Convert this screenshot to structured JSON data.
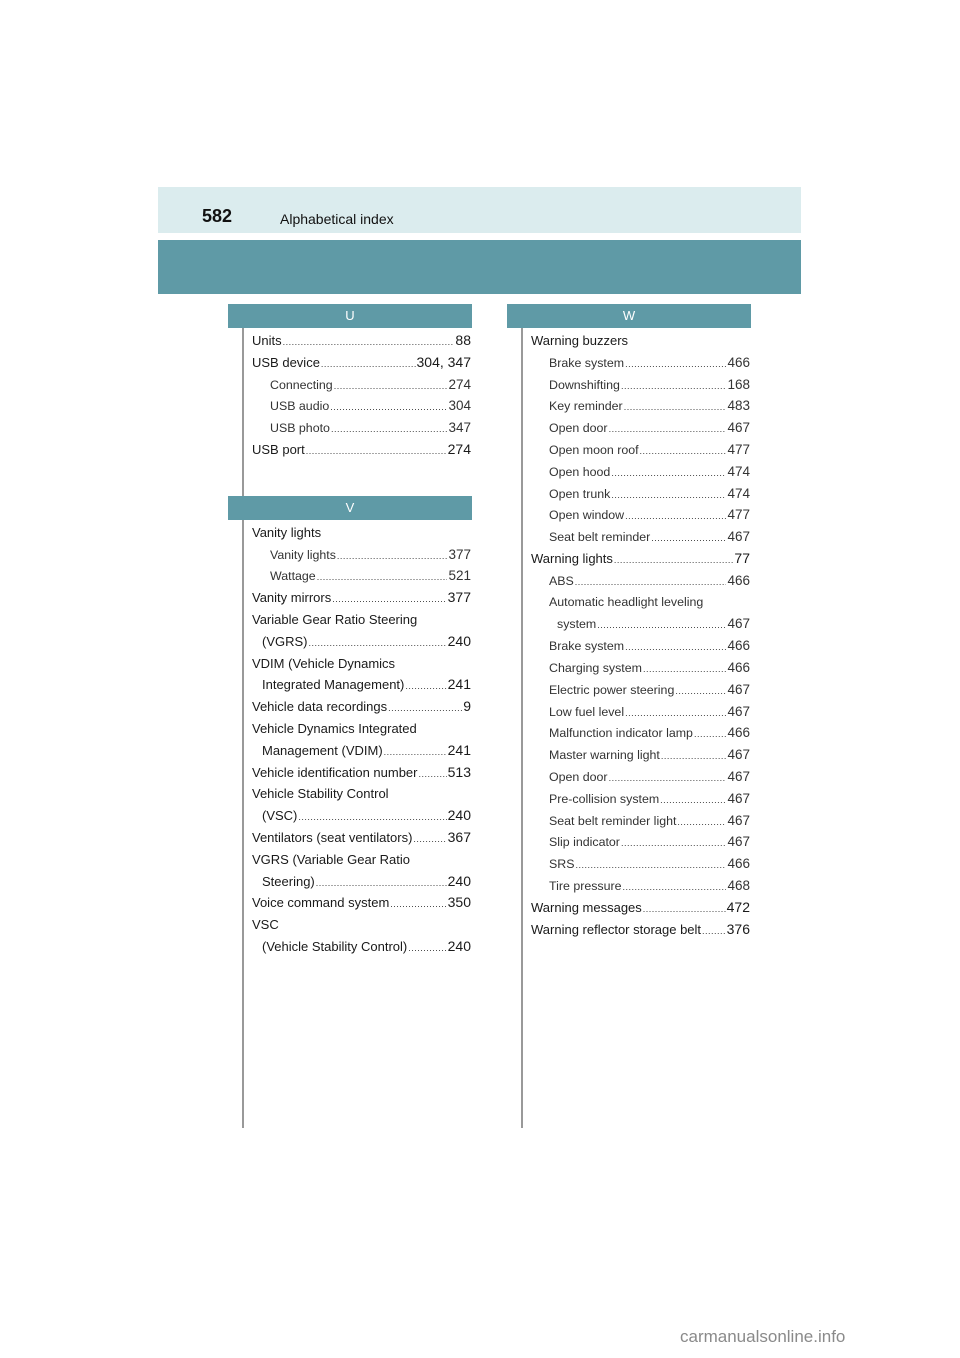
{
  "header": {
    "page_number": "582",
    "section_title": "Alphabetical index"
  },
  "sections": [
    {
      "letter": "U",
      "entries": [
        {
          "label": "Units",
          "page": "88",
          "level": 0
        },
        {
          "label": "USB device",
          "page": "304, 347",
          "level": 0
        },
        {
          "label": "Connecting",
          "page": "274",
          "level": 1
        },
        {
          "label": "USB audio",
          "page": "304",
          "level": 1
        },
        {
          "label": "USB photo",
          "page": "347",
          "level": 1
        },
        {
          "label": "USB port",
          "page": "274",
          "level": 0
        }
      ]
    },
    {
      "letter": "V",
      "entries": [
        {
          "label": "Vanity lights",
          "page": "",
          "level": 0
        },
        {
          "label": "Vanity lights",
          "page": "377",
          "level": 1
        },
        {
          "label": "Wattage",
          "page": "521",
          "level": 1
        },
        {
          "label": "Vanity mirrors",
          "page": "377",
          "level": 0
        },
        {
          "label": "Variable Gear Ratio Steering",
          "page": "",
          "level": 0
        },
        {
          "label": "(VGRS)",
          "page": "240",
          "level": 0,
          "cont": true
        },
        {
          "label": "VDIM (Vehicle Dynamics",
          "page": "",
          "level": 0
        },
        {
          "label": "Integrated Management)",
          "page": "241",
          "level": 0,
          "cont": true
        },
        {
          "label": "Vehicle data recordings",
          "page": "9",
          "level": 0
        },
        {
          "label": "Vehicle Dynamics Integrated",
          "page": "",
          "level": 0
        },
        {
          "label": "Management (VDIM)",
          "page": "241",
          "level": 0,
          "cont": true
        },
        {
          "label": "Vehicle identification number",
          "page": "513",
          "level": 0
        },
        {
          "label": "Vehicle Stability Control",
          "page": "",
          "level": 0
        },
        {
          "label": "(VSC)",
          "page": "240",
          "level": 0,
          "cont": true
        },
        {
          "label": "Ventilators (seat ventilators)",
          "page": "367",
          "level": 0
        },
        {
          "label": "VGRS (Variable Gear Ratio",
          "page": "",
          "level": 0
        },
        {
          "label": "Steering)",
          "page": "240",
          "level": 0,
          "cont": true
        },
        {
          "label": "Voice command system",
          "page": "350",
          "level": 0
        },
        {
          "label": "VSC",
          "page": "",
          "level": 0
        },
        {
          "label": "(Vehicle Stability Control)",
          "page": "240",
          "level": 0,
          "cont": true
        }
      ]
    },
    {
      "letter": "W",
      "entries": [
        {
          "label": "Warning buzzers",
          "page": "",
          "level": 0
        },
        {
          "label": "Brake system",
          "page": "466",
          "level": 1
        },
        {
          "label": "Downshifting",
          "page": "168",
          "level": 1
        },
        {
          "label": "Key reminder",
          "page": "483",
          "level": 1
        },
        {
          "label": "Open door",
          "page": "467",
          "level": 1
        },
        {
          "label": "Open moon roof",
          "page": "477",
          "level": 1
        },
        {
          "label": "Open hood",
          "page": "474",
          "level": 1
        },
        {
          "label": "Open trunk",
          "page": "474",
          "level": 1
        },
        {
          "label": "Open window",
          "page": "477",
          "level": 1
        },
        {
          "label": "Seat belt reminder",
          "page": "467",
          "level": 1
        },
        {
          "label": "Warning lights",
          "page": "77",
          "level": 0
        },
        {
          "label": "ABS",
          "page": "466",
          "level": 1
        },
        {
          "label": "Automatic headlight leveling",
          "page": "",
          "level": 1
        },
        {
          "label": "system",
          "page": "467",
          "level": 1,
          "cont": true
        },
        {
          "label": "Brake system",
          "page": "466",
          "level": 1
        },
        {
          "label": "Charging system",
          "page": "466",
          "level": 1
        },
        {
          "label": "Electric power steering",
          "page": "467",
          "level": 1
        },
        {
          "label": "Low fuel level",
          "page": "467",
          "level": 1
        },
        {
          "label": "Malfunction indicator lamp",
          "page": "466",
          "level": 1
        },
        {
          "label": "Master warning light",
          "page": "467",
          "level": 1
        },
        {
          "label": "Open door",
          "page": "467",
          "level": 1
        },
        {
          "label": "Pre-collision system",
          "page": "467",
          "level": 1
        },
        {
          "label": "Seat belt reminder light",
          "page": "467",
          "level": 1
        },
        {
          "label": "Slip indicator",
          "page": "467",
          "level": 1
        },
        {
          "label": "SRS",
          "page": "466",
          "level": 1
        },
        {
          "label": "Tire pressure",
          "page": "468",
          "level": 1
        },
        {
          "label": "Warning messages",
          "page": "472",
          "level": 0
        },
        {
          "label": "Warning reflector storage belt",
          "page": "376",
          "level": 0
        }
      ]
    }
  ],
  "footer": {
    "watermark": "carmanualsonline.info"
  }
}
